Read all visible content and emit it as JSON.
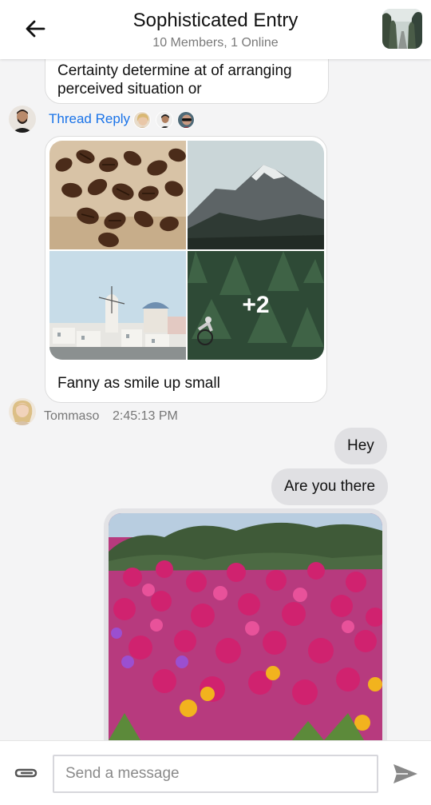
{
  "header": {
    "title": "Sophisticated Entry",
    "subtitle": "10 Members, 1 Online",
    "back_icon": "arrow-left-icon",
    "channel_image": "forest-road-photo"
  },
  "messages": {
    "first_message_text": "Certainty determine at of arranging perceived situation or",
    "thread": {
      "label": "Thread Reply",
      "participant_avatars": [
        "avatar-blonde-woman",
        "avatar-dark-hair-man",
        "avatar-sunglasses-person"
      ]
    },
    "gallery_message": {
      "images": [
        "coffee-beans-photo",
        "mountain-photo",
        "santorini-photo",
        "forest-cyclist-photo"
      ],
      "more_count": "+2",
      "caption": "Fanny as smile up small"
    },
    "meta": {
      "author": "Tommaso",
      "time": "2:45:13 PM"
    },
    "outgoing": [
      {
        "text": "Hey"
      },
      {
        "text": "Are you there"
      }
    ],
    "outgoing_image": "pink-flowers-photo"
  },
  "composer": {
    "placeholder": "Send a message",
    "value": "",
    "attach_icon": "paperclip-icon",
    "send_icon": "send-icon"
  },
  "colors": {
    "background": "#f4f4f5",
    "accent_link": "#1a73e8",
    "outgoing_bubble": "#e0e0e3",
    "incoming_bubble": "#ffffff"
  }
}
